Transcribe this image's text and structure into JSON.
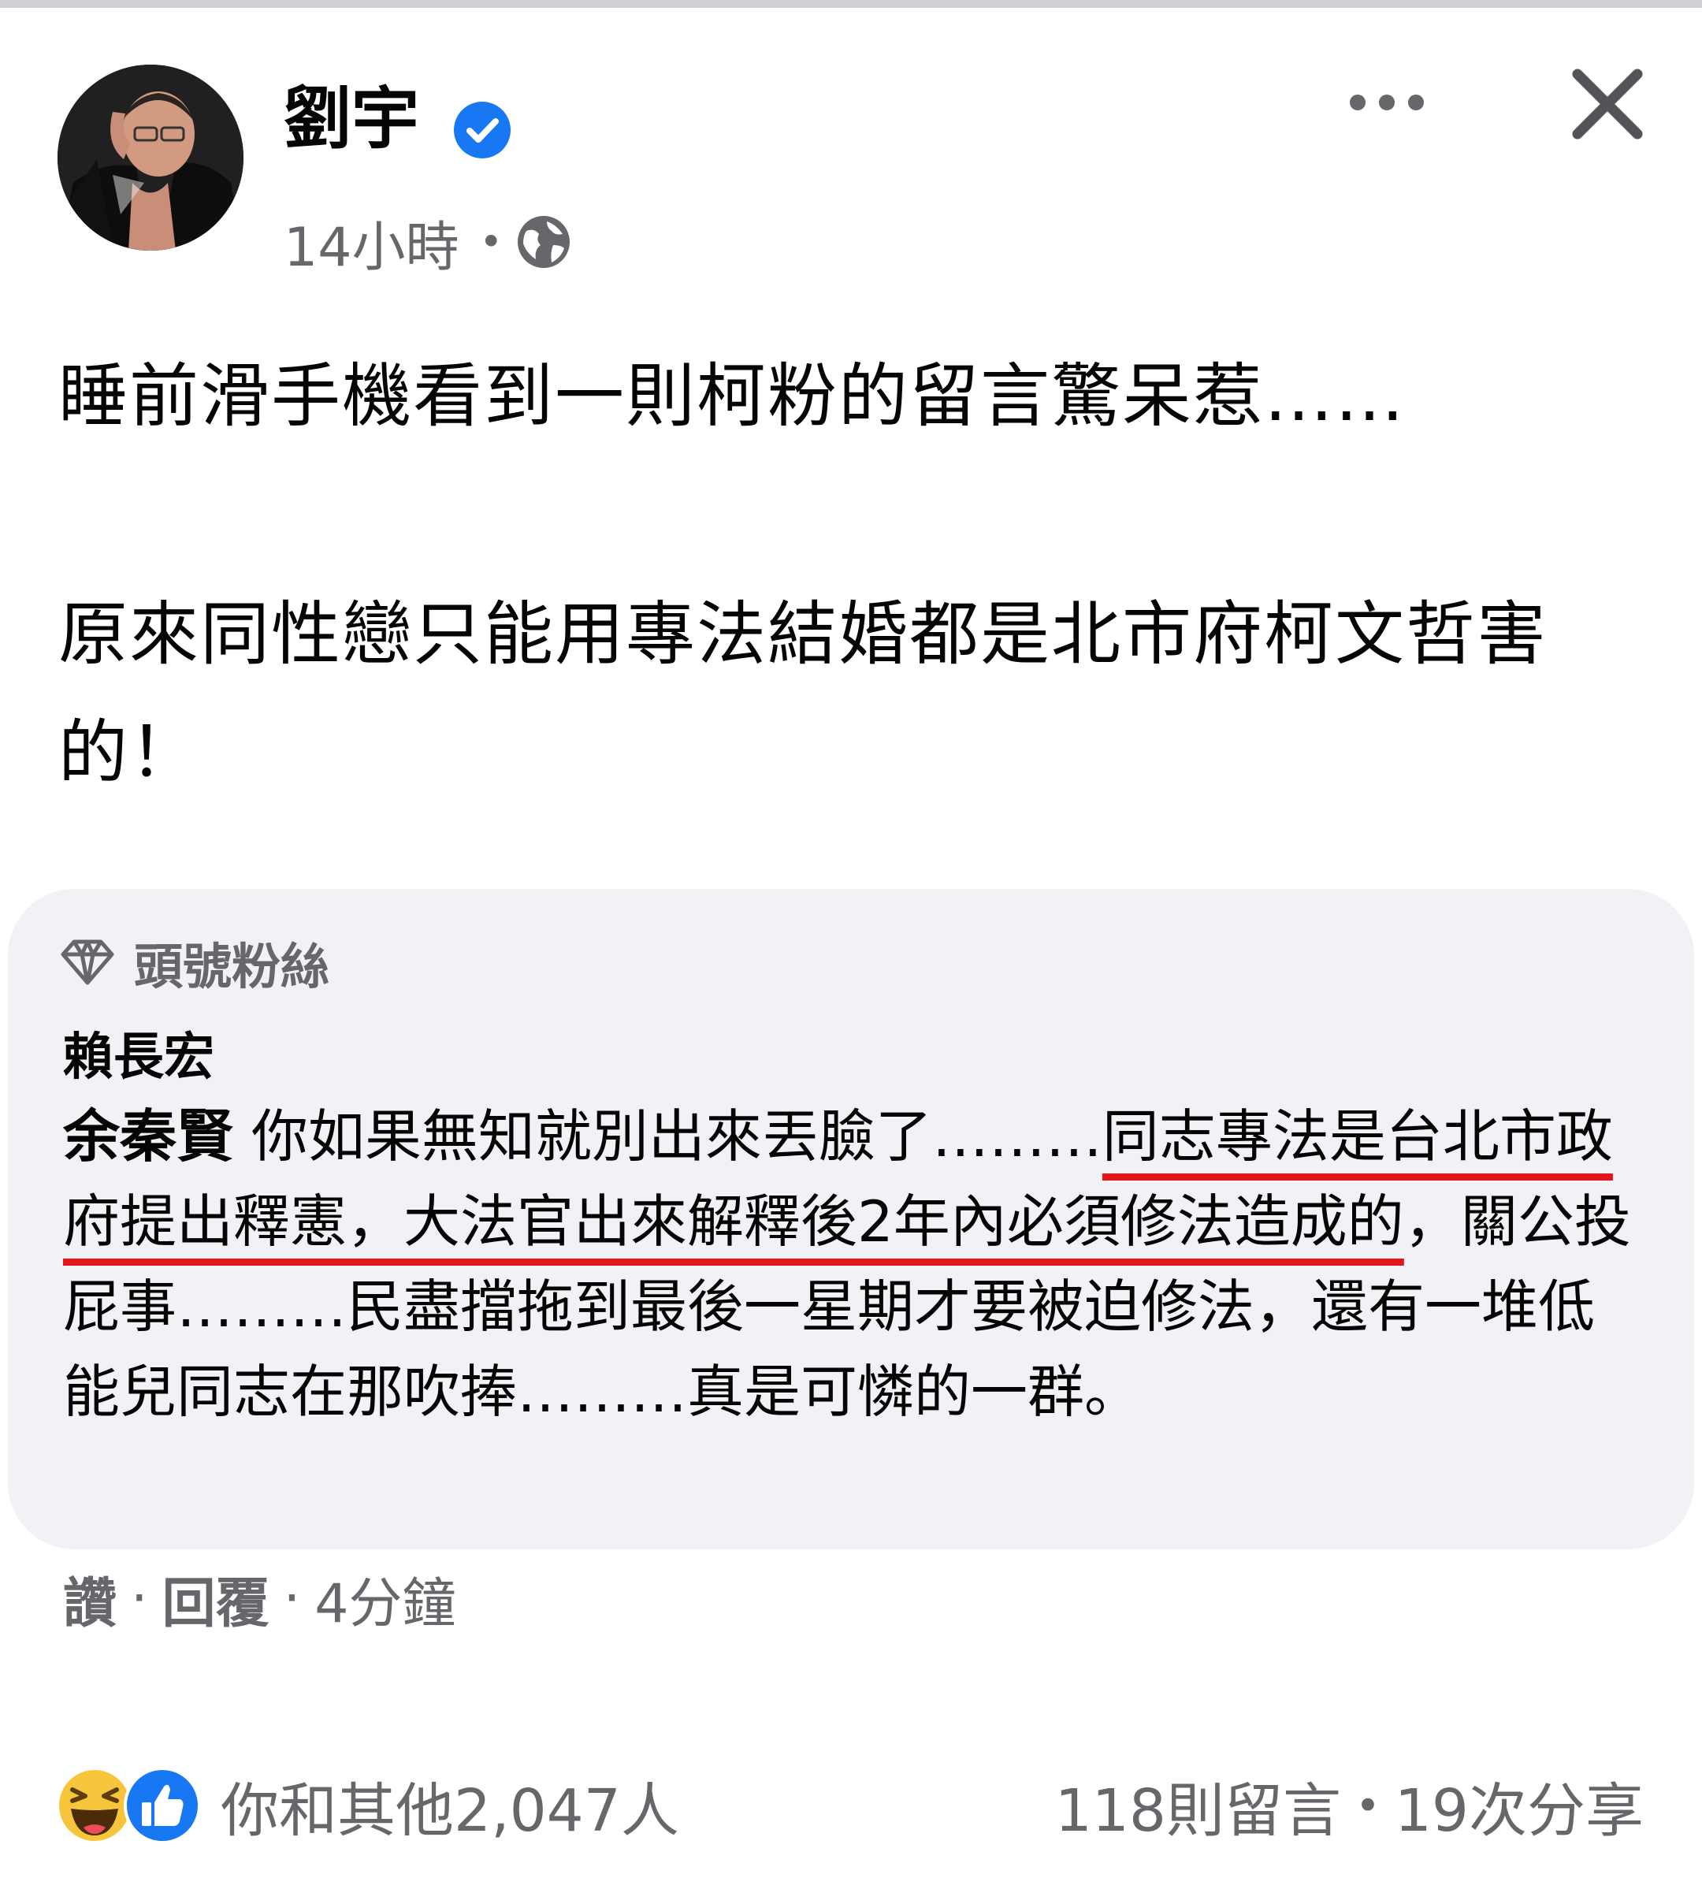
{
  "post": {
    "author": "劉宇",
    "time": "14小時",
    "text_line1": "睡前滑手機看到一則柯粉的留言驚呆惹……",
    "text_line2": "原來同性戀只能用專法結婚都是北市府柯文哲害的！"
  },
  "comment": {
    "badge": "頭號粉絲",
    "commenter": "賴長宏",
    "mention": "余秦賢",
    "text_before": " 你如果無知就別出來丟臉了………",
    "text_highlight": "同志專法是台北市政府提出釋憲，大法官出來解釋後2年內必須修法造成的",
    "text_after": "，關公投屁事………民盡擋拖到最後一星期才要被迫修法，還有一堆低能兒同志在那吹捧………真是可憐的一群。",
    "action_like": "讚",
    "action_reply": "回覆",
    "time": "4分鐘"
  },
  "footer": {
    "reactions_text": "你和其他2,047人",
    "comments": "118則留言",
    "shares": "19次分享"
  },
  "colors": {
    "accent": "#1877f2",
    "muted": "#65676b",
    "underline": "#e4141b",
    "card": "#f0f2f5"
  },
  "icons": [
    "verified-icon",
    "globe-icon",
    "more-icon",
    "close-icon",
    "diamond-icon",
    "haha-reaction-icon",
    "like-reaction-icon"
  ]
}
